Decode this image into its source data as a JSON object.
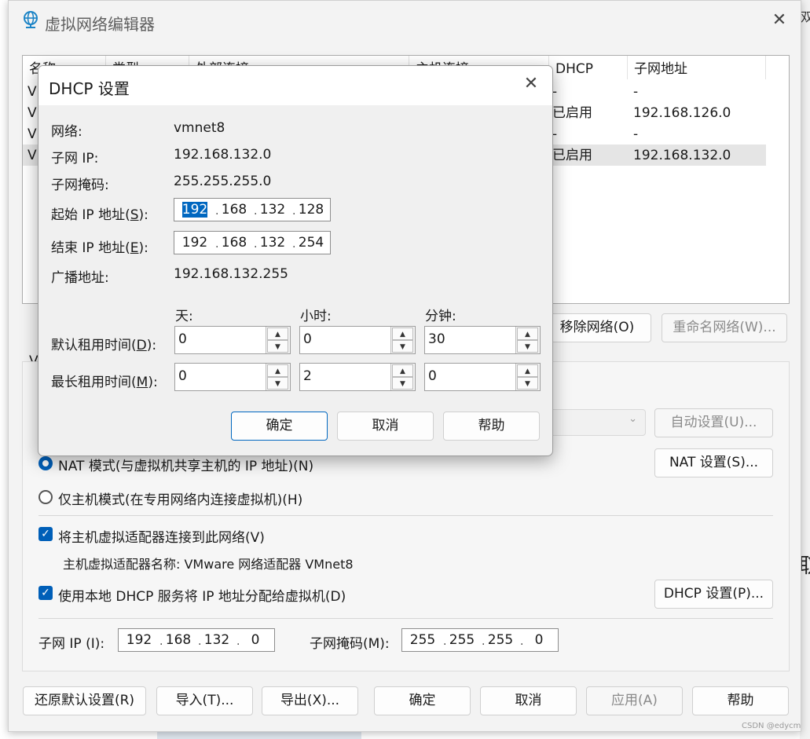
{
  "main": {
    "title": "虚拟网络编辑器",
    "columns": {
      "name": "名称",
      "type": "类型",
      "external": "外部连接",
      "host": "主机连接",
      "dhcp": "DHCP",
      "subnet": "子网地址"
    },
    "rows": [
      {
        "name": "VI",
        "dhcp": "-",
        "subnet": "-"
      },
      {
        "name": "VI",
        "dhcp": "已启用",
        "subnet": "192.168.126.0"
      },
      {
        "name": "VI",
        "dhcp": "-",
        "subnet": "-"
      },
      {
        "name": "VI",
        "dhcp": "已启用",
        "subnet": "192.168.132.0"
      }
    ],
    "remove_net": "移除网络(O)",
    "rename_net": "重命名网络(W)...",
    "group_label": "V",
    "auto_set": "自动设置(U)...",
    "nat_mode": "NAT 模式(与虚拟机共享主机的 IP 地址)(N)",
    "nat_settings": "NAT 设置(S)...",
    "host_only": "仅主机模式(在专用网络内连接虚拟机)(H)",
    "connect_adapter": "将主机虚拟适配器连接到此网络(V)",
    "adapter_name": "主机虚拟适配器名称: VMware 网络适配器 VMnet8",
    "use_dhcp": "使用本地 DHCP 服务将 IP 地址分配给虚拟机(D)",
    "dhcp_settings": "DHCP 设置(P)...",
    "subnet_ip_label": "子网 IP (I):",
    "subnet_ip": [
      "192",
      "168",
      "132",
      "0"
    ],
    "subnet_mask_label": "子网掩码(M):",
    "subnet_mask": [
      "255",
      "255",
      "255",
      "0"
    ],
    "restore": "还原默认设置(R)",
    "import": "导入(T)...",
    "export": "导出(X)...",
    "ok": "确定",
    "cancel": "取消",
    "apply": "应用(A)",
    "help": "帮助"
  },
  "dhcp": {
    "title": "DHCP 设置",
    "network_label": "网络:",
    "network_value": "vmnet8",
    "subnet_ip_label": "子网 IP:",
    "subnet_ip_value": "192.168.132.0",
    "subnet_mask_label": "子网掩码:",
    "subnet_mask_value": "255.255.255.0",
    "start_ip_label_a": "起始 IP 地址(",
    "start_ip_key": "S",
    "start_ip_label_b": "):",
    "start_ip": [
      "192",
      "168",
      "132",
      "128"
    ],
    "end_ip_label_a": "结束 IP 地址(",
    "end_ip_key": "E",
    "end_ip_label_b": "):",
    "end_ip": [
      "192",
      "168",
      "132",
      "254"
    ],
    "broadcast_label": "广播地址:",
    "broadcast_value": "192.168.132.255",
    "days_label": "天:",
    "hours_label": "小时:",
    "minutes_label": "分钟:",
    "default_lease_label_a": "默认租用时间(",
    "default_lease_key": "D",
    "default_lease_label_b": "):",
    "default_lease": [
      "0",
      "0",
      "30"
    ],
    "max_lease_label_a": "最长租用时间(",
    "max_lease_key": "M",
    "max_lease_label_b": "):",
    "max_lease": [
      "0",
      "2",
      "0"
    ],
    "ok": "确定",
    "cancel": "取消",
    "help": "帮助"
  },
  "background": {
    "right_char_top": "双",
    "right_char_mid": "取",
    "watermark": "CSDN @edycm"
  },
  "colors": {
    "accent": "#005fb8",
    "selection": "#0067c0"
  }
}
